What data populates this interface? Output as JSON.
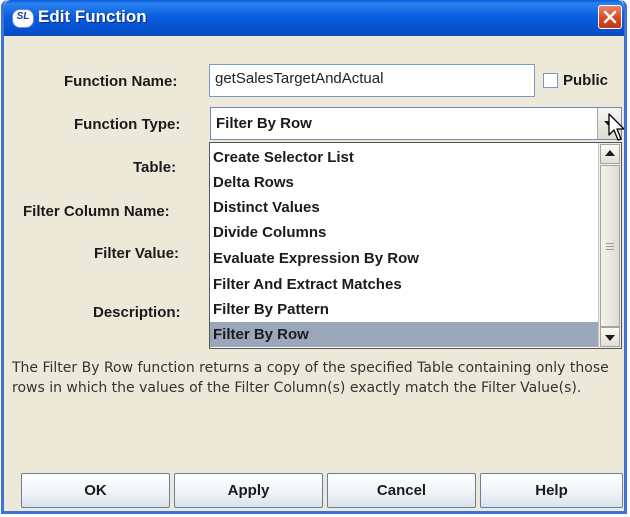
{
  "window": {
    "title": "Edit Function",
    "app_icon_text": "SL"
  },
  "form": {
    "function_name_label": "Function Name:",
    "function_name_value": "getSalesTargetAndActual",
    "public_label": "Public",
    "public_checked": false,
    "function_type_label": "Function Type:",
    "function_type_value": "Filter By Row",
    "table_label": "Table:",
    "filter_column_label": "Filter Column Name:",
    "filter_value_label": "Filter Value:",
    "description_label": "Description:"
  },
  "dropdown": {
    "items": [
      "Create Selector List",
      "Delta Rows",
      "Distinct Values",
      "Divide Columns",
      "Evaluate Expression By Row",
      "Filter And Extract Matches",
      "Filter By Pattern",
      "Filter By Row"
    ],
    "selected": "Filter By Row"
  },
  "description_text": "The Filter By Row function returns a copy of the specified Table containing only those rows in which the values of the Filter Column(s) exactly match the Filter Value(s).",
  "buttons": {
    "ok": "OK",
    "apply": "Apply",
    "cancel": "Cancel",
    "help": "Help"
  },
  "colors": {
    "titlebar": "#0b5ee0",
    "close": "#d4441f",
    "selected_row": "#9aa7ba",
    "dialog_bg": "#ece9d8"
  }
}
